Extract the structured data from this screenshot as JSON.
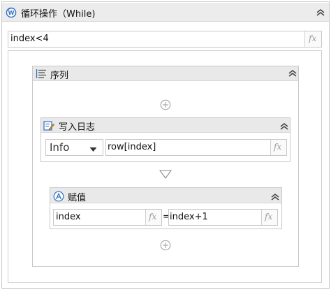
{
  "while_activity": {
    "title": "循环操作（While)",
    "condition_value": "index<4",
    "fx_label": "fx"
  },
  "sequence": {
    "title": "序列"
  },
  "log_message": {
    "title": "写入日志",
    "level": "Info",
    "message_value": "row[index]",
    "fx_label": "fx"
  },
  "assign": {
    "title": "赋值",
    "to_value": "index",
    "equals": "=",
    "value": "index+1",
    "fx_label": "fx"
  },
  "icons": [
    "while-icon",
    "collapse-icon",
    "sequence-icon",
    "add-activity-icon",
    "log-message-icon",
    "dropdown-arrow-icon",
    "flow-arrow-icon",
    "assign-icon"
  ]
}
